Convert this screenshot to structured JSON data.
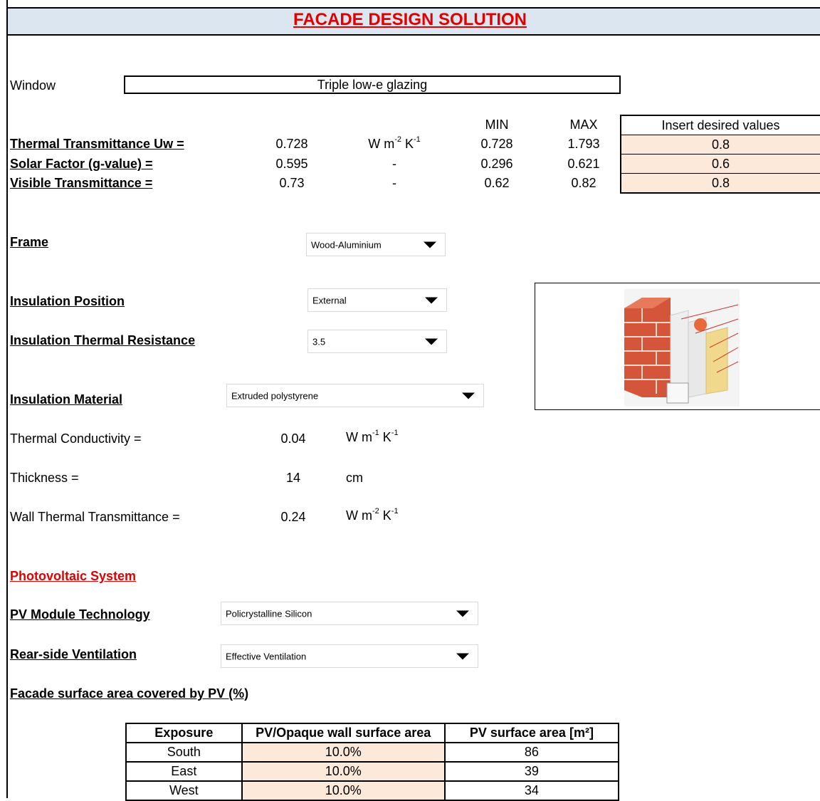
{
  "header": {
    "title": "FACADE DESIGN SOLUTION"
  },
  "window": {
    "label": "Window",
    "value": "Triple low-e glazing"
  },
  "window_props": {
    "col_min": "MIN",
    "col_max": "MAX",
    "col_insert": "Insert desired values",
    "rows": [
      {
        "label": "Thermal Transmittance Uw =",
        "value": "0.728",
        "unit_base": "W m",
        "unit_exp1": "-2",
        "unit_k": " K",
        "unit_exp2": "-1",
        "min": "0.728",
        "max": "1.793",
        "desired": "0.8"
      },
      {
        "label": "Solar Factor (g-value) =",
        "value": "0.595",
        "unit_text": "-",
        "min": "0.296",
        "max": "0.621",
        "desired": "0.6"
      },
      {
        "label": "Visible Transmittance =",
        "value": "0.73",
        "unit_text": "-",
        "min": "0.62",
        "max": "0.82",
        "desired": "0.8"
      }
    ]
  },
  "frame": {
    "label": "Frame",
    "selected": "Wood-Aluminium"
  },
  "insulation_position": {
    "label": "Insulation Position",
    "selected": "External"
  },
  "insulation_resistance": {
    "label": "Insulation Thermal Resistance",
    "selected": "3.5"
  },
  "insulation_material": {
    "label": "Insulation Material",
    "selected": "Extruded polystyrene"
  },
  "thermal_conductivity": {
    "label": "Thermal Conductivity =",
    "value": "0.04",
    "unit_base": "W m",
    "unit_exp1": "-1",
    "unit_k": " K",
    "unit_exp2": "-1"
  },
  "thickness": {
    "label": "Thickness =",
    "value": "14",
    "unit": "cm"
  },
  "wall_transmittance": {
    "label": "Wall Thermal Transmittance =",
    "value": "0.24",
    "unit_base": "W m",
    "unit_exp1": "-2",
    "unit_k": " K",
    "unit_exp2": "-1"
  },
  "pv_section": {
    "title": "Photovoltaic System"
  },
  "pv_technology": {
    "label": "PV Module Technology",
    "selected": "Policrystalline Silicon"
  },
  "rear_ventilation": {
    "label": "Rear-side Ventilation",
    "selected": "Effective Ventilation"
  },
  "pv_coverage": {
    "title": "Facade surface area covered by PV (%)",
    "headers": [
      "Exposure",
      "PV/Opaque wall surface area",
      "PV surface area [m²]"
    ],
    "rows": [
      {
        "exposure": "South",
        "ratio": "10.0%",
        "area": "86"
      },
      {
        "exposure": "East",
        "ratio": "10.0%",
        "area": "39"
      },
      {
        "exposure": "West",
        "ratio": "10.0%",
        "area": "34"
      }
    ]
  },
  "colors": {
    "header_bg": "#dce6f1",
    "title_red": "#e00000",
    "input_peach": "#fde9d9"
  },
  "icons": [
    "dropdown-arrow-icon",
    "brick-wall-insulation-illustration"
  ]
}
